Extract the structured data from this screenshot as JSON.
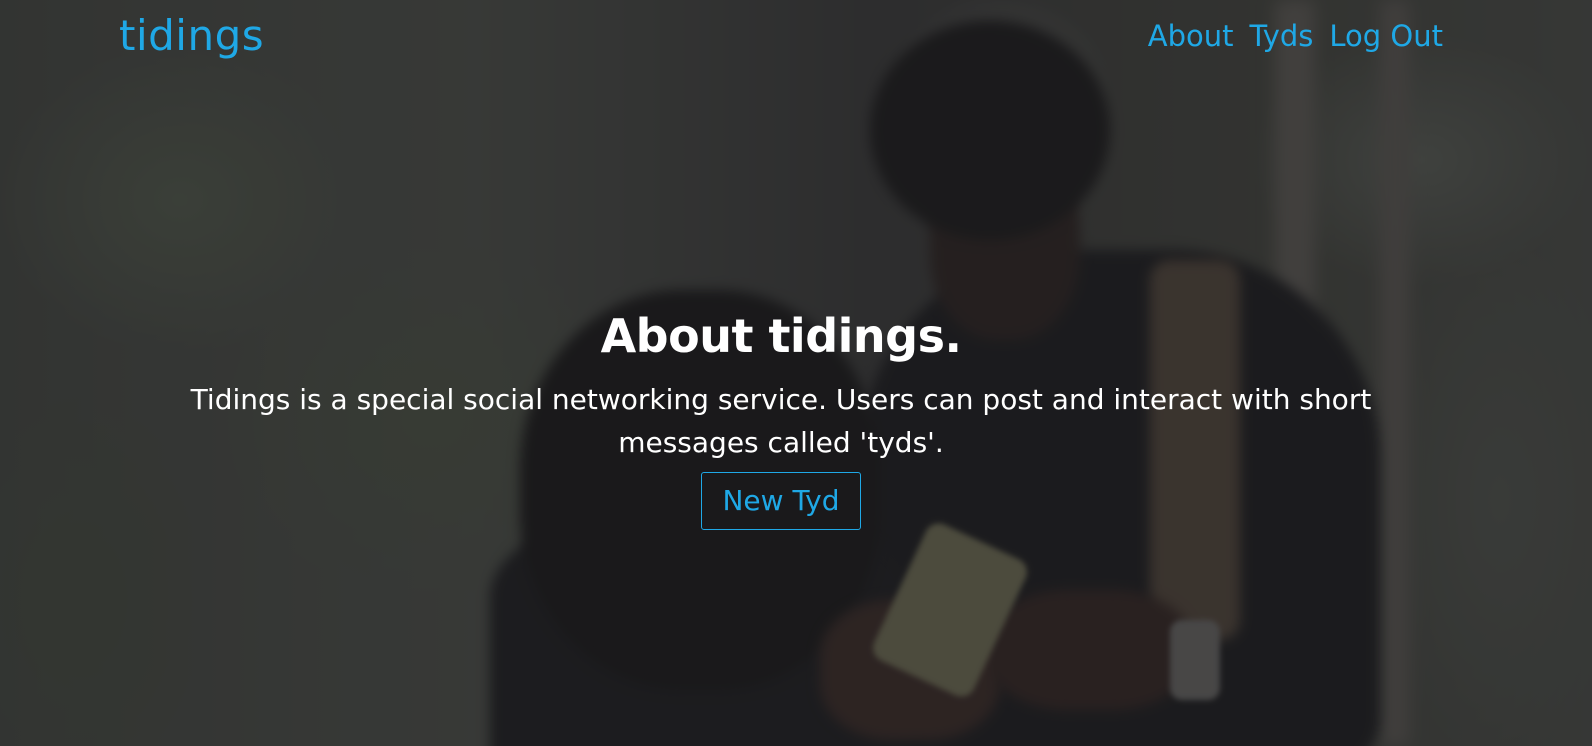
{
  "colors": {
    "accent": "#1fa8e6",
    "text": "#ffffff",
    "overlay": "#1c1c1e"
  },
  "navbar": {
    "brand": "tidings",
    "links": [
      {
        "label": "About"
      },
      {
        "label": "Tyds"
      },
      {
        "label": "Log Out"
      }
    ]
  },
  "hero": {
    "title": "About tidings.",
    "text": "Tidings is a special social networking service. Users can post and interact with short messages called 'tyds'.",
    "button_label": "New Tyd"
  },
  "background": {
    "image": "blurred photo of two people looking at phones"
  }
}
